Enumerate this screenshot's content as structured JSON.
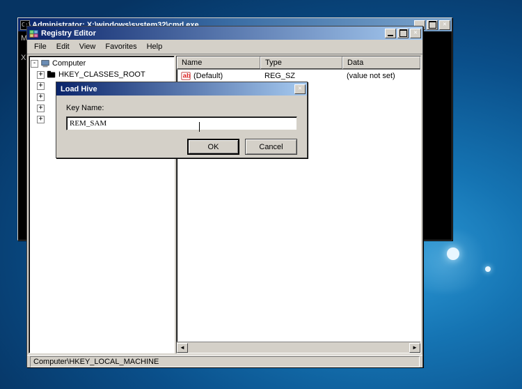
{
  "cmd": {
    "title": "Administrator: X:\\windows\\system32\\cmd.exe",
    "line1": "Mi",
    "line2": "X:"
  },
  "regedit": {
    "title": "Registry Editor",
    "menu": {
      "file": "File",
      "edit": "Edit",
      "view": "View",
      "favorites": "Favorites",
      "help": "Help"
    },
    "tree": {
      "root": "Computer",
      "items": [
        "HKEY_CLASSES_ROOT"
      ]
    },
    "list": {
      "headers": {
        "name": "Name",
        "type": "Type",
        "data": "Data"
      },
      "rows": [
        {
          "name": "(Default)",
          "type": "REG_SZ",
          "data": "(value not set)"
        }
      ]
    },
    "status": "Computer\\HKEY_LOCAL_MACHINE"
  },
  "dialog": {
    "title": "Load Hive",
    "keyname_label": "Key Name:",
    "keyname_value": "REM_SAM",
    "ok": "OK",
    "cancel": "Cancel"
  }
}
